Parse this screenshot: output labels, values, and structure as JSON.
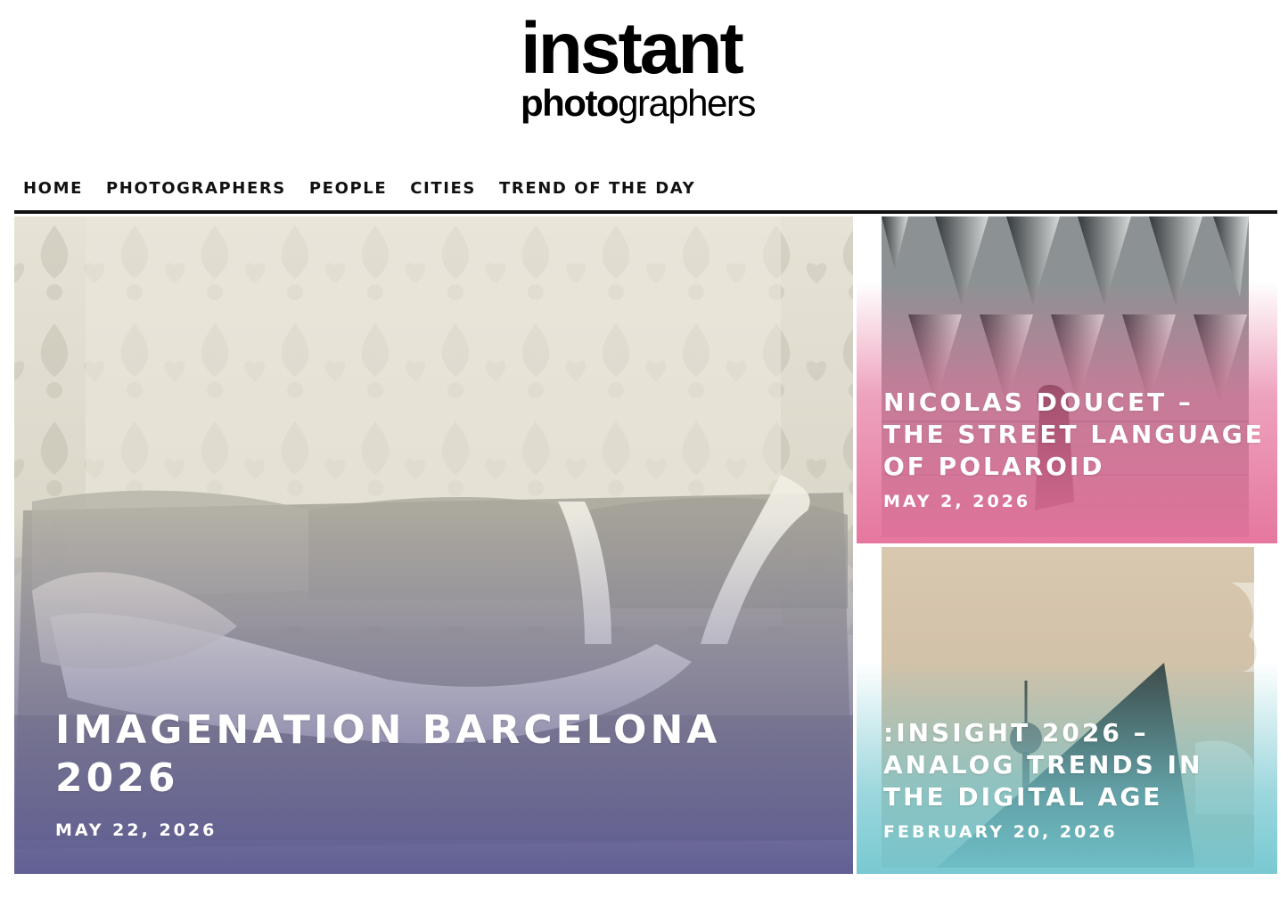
{
  "logo": {
    "line1": "instant",
    "line2_strong": "photo",
    "line2_light": "graphers"
  },
  "nav": {
    "items": [
      "HOME",
      "PHOTOGRAPHERS",
      "PEOPLE",
      "CITIES",
      "TREND OF THE DAY"
    ]
  },
  "featured": {
    "title": "IMAGENATION BARCELONA 2026",
    "date": "MAY 22, 2026"
  },
  "side_cards": [
    {
      "title": "NICOLAS DOUCET – THE STREET LANGUAGE OF POLAROID",
      "date": "MAY 2, 2026"
    },
    {
      "title": ":INSIGHT 2026 – ANALOG TRENDS IN THE DIGITAL AGE",
      "date": "FEBRUARY 20, 2026"
    }
  ],
  "colors": {
    "featured_overlay": "#5c5a92",
    "top_card_overlay": "#e4709a",
    "bottom_card_overlay": "#72c6cf",
    "nav_rule": "#111111"
  }
}
